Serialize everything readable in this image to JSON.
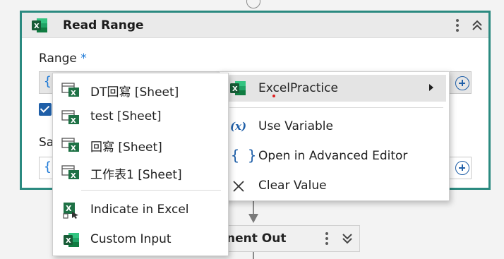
{
  "activity": {
    "title": "Read Range",
    "range_label": "Range",
    "required_mark": "*",
    "brace_glyph": "{",
    "sa_label_partial": "Sa"
  },
  "next_activity": {
    "title_partial": "nent Out"
  },
  "sheet_menu": {
    "items": [
      {
        "label": "DT回寫 [Sheet]",
        "icon": "excel-sheet-icon"
      },
      {
        "label": "test [Sheet]",
        "icon": "excel-sheet-icon"
      },
      {
        "label": "回寫 [Sheet]",
        "icon": "excel-sheet-icon"
      },
      {
        "label": "工作表1 [Sheet]",
        "icon": "excel-sheet-icon"
      },
      {
        "label": "Indicate in Excel",
        "icon": "indicate-excel-icon"
      },
      {
        "label": "Custom Input",
        "icon": "excel-icon"
      }
    ]
  },
  "main_menu": {
    "items": [
      {
        "label": "ExcelPractice",
        "icon": "excel-icon",
        "highlighted": true,
        "has_submenu": true
      },
      {
        "label": "Use Variable",
        "icon": "variable-icon"
      },
      {
        "label": "Open in Advanced Editor",
        "icon": "braces-icon"
      },
      {
        "label": "Clear Value",
        "icon": "close-icon"
      }
    ]
  },
  "colors": {
    "card_border": "#2b8a80",
    "excel_green": "#1e7145",
    "accent_blue": "#1f5fa8",
    "highlight": "#e4e4e4"
  }
}
